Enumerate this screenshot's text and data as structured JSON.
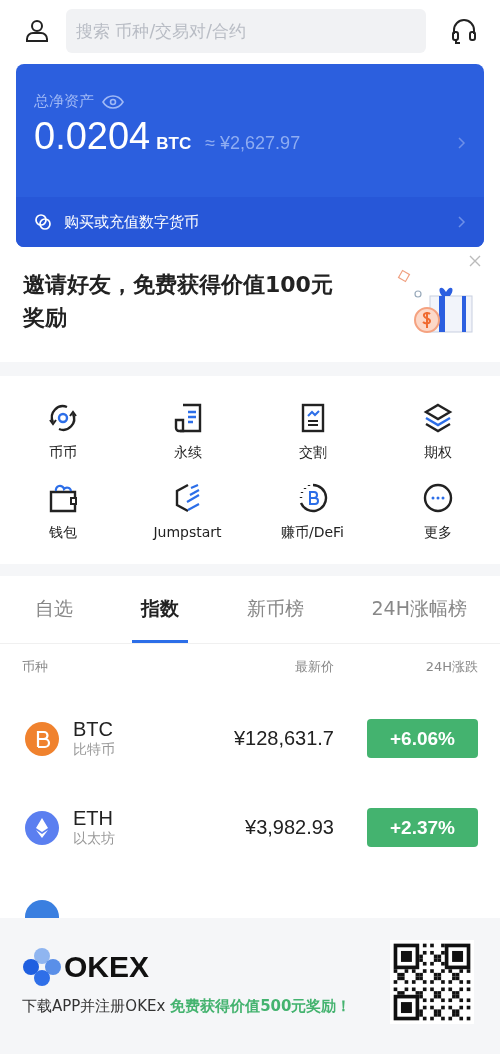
{
  "search": {
    "placeholder": "搜索 币种/交易对/合约"
  },
  "assets": {
    "label": "总净资产",
    "amount": "0.0204",
    "unit": "BTC",
    "fiat": "≈ ¥2,627.97",
    "buy_link": "购买或充值数字货币"
  },
  "invite": {
    "text": "邀请好友，免费获得价值100元奖励"
  },
  "shortcuts": [
    {
      "label": "币币",
      "kind": "spot"
    },
    {
      "label": "永续",
      "kind": "swap"
    },
    {
      "label": "交割",
      "kind": "futures"
    },
    {
      "label": "期权",
      "kind": "options"
    },
    {
      "label": "钱包",
      "kind": "wallet"
    },
    {
      "label": "Jumpstart",
      "kind": "jumpstart"
    },
    {
      "label": "赚币/DeFi",
      "kind": "earn"
    },
    {
      "label": "更多",
      "kind": "more"
    }
  ],
  "tabs": [
    {
      "label": "自选",
      "selected": false
    },
    {
      "label": "指数",
      "selected": true
    },
    {
      "label": "新币榜",
      "selected": false
    },
    {
      "label": "24H涨幅榜",
      "selected": false
    }
  ],
  "table": {
    "columns": [
      "币种",
      "最新价",
      "24H涨跌"
    ],
    "rows": [
      {
        "symbol": "BTC",
        "name": "比特币",
        "price": "¥128,631.7",
        "change": "+6.06%",
        "color": "#f0822e"
      },
      {
        "symbol": "ETH",
        "name": "以太坊",
        "price": "¥3,982.93",
        "change": "+2.37%",
        "color": "#5b7ff0"
      },
      {
        "color": "#3a7fe0"
      }
    ]
  },
  "footer": {
    "brand": "OKEX",
    "text": "下载APP并注册OKEx **免费获得价值500元奖励！**"
  }
}
